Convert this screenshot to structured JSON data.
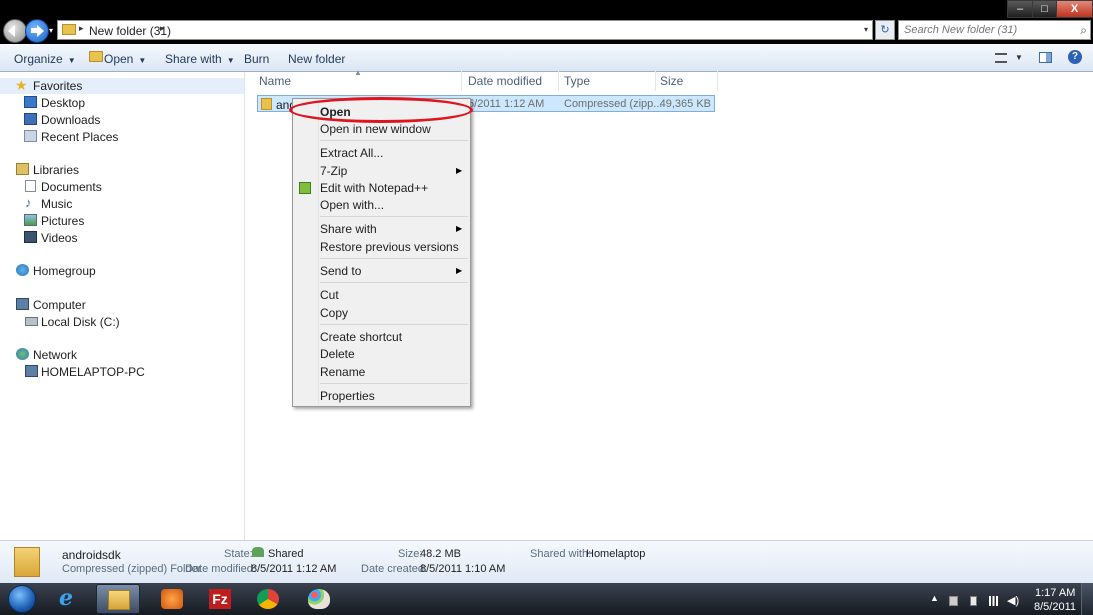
{
  "window": {
    "address_path": "New folder (31)",
    "search_placeholder": "Search New folder (31)",
    "controls": {
      "minimize": "–",
      "maximize": "□",
      "close": "X"
    }
  },
  "toolbar": {
    "organize": "Organize",
    "open": "Open",
    "share_with": "Share with",
    "burn": "Burn",
    "new_folder": "New folder",
    "help": "?"
  },
  "nav": {
    "favorites": "Favorites",
    "desktop": "Desktop",
    "downloads": "Downloads",
    "recent_places": "Recent Places",
    "libraries": "Libraries",
    "documents": "Documents",
    "music": "Music",
    "pictures": "Pictures",
    "videos": "Videos",
    "homegroup": "Homegroup",
    "computer": "Computer",
    "local_disk": "Local Disk (C:)",
    "network": "Network",
    "homelaptop_pc": "HOMELAPTOP-PC"
  },
  "columns": {
    "name": "Name",
    "date_modified": "Date modified",
    "type": "Type",
    "size": "Size"
  },
  "file": {
    "name_visible": "and",
    "date_visible": "/5/2011 1:12 AM",
    "type_visible": "Compressed (zipp...",
    "size": "49,365 KB"
  },
  "context_menu": {
    "open": "Open",
    "open_new_window": "Open in new window",
    "extract_all": "Extract All...",
    "seven_zip": "7-Zip",
    "edit_notepad": "Edit with Notepad++",
    "open_with": "Open with...",
    "share_with": "Share with",
    "restore_versions": "Restore previous versions",
    "send_to": "Send to",
    "cut": "Cut",
    "copy": "Copy",
    "create_shortcut": "Create shortcut",
    "delete": "Delete",
    "rename": "Rename",
    "properties": "Properties"
  },
  "details": {
    "name": "androidsdk",
    "type": "Compressed (zipped) Folder",
    "state_label": "State:",
    "state_value": "Shared",
    "date_modified_label": "Date modified:",
    "date_modified_value": "8/5/2011 1:12 AM",
    "size_label": "Size:",
    "size_value": "48.2 MB",
    "date_created_label": "Date created:",
    "date_created_value": "8/5/2011 1:10 AM",
    "shared_with_label": "Shared with:",
    "shared_with_value": "Homelaptop"
  },
  "taskbar": {
    "clock_time": "1:17 AM",
    "clock_date": "8/5/2011",
    "apps": [
      "internet-explorer",
      "windows-explorer",
      "media-player",
      "filezilla",
      "chrome",
      "paint"
    ]
  },
  "colors": {
    "selection": "#cce8ff",
    "annotation_red": "#e0141e",
    "toolbar_text": "#1e395b"
  }
}
